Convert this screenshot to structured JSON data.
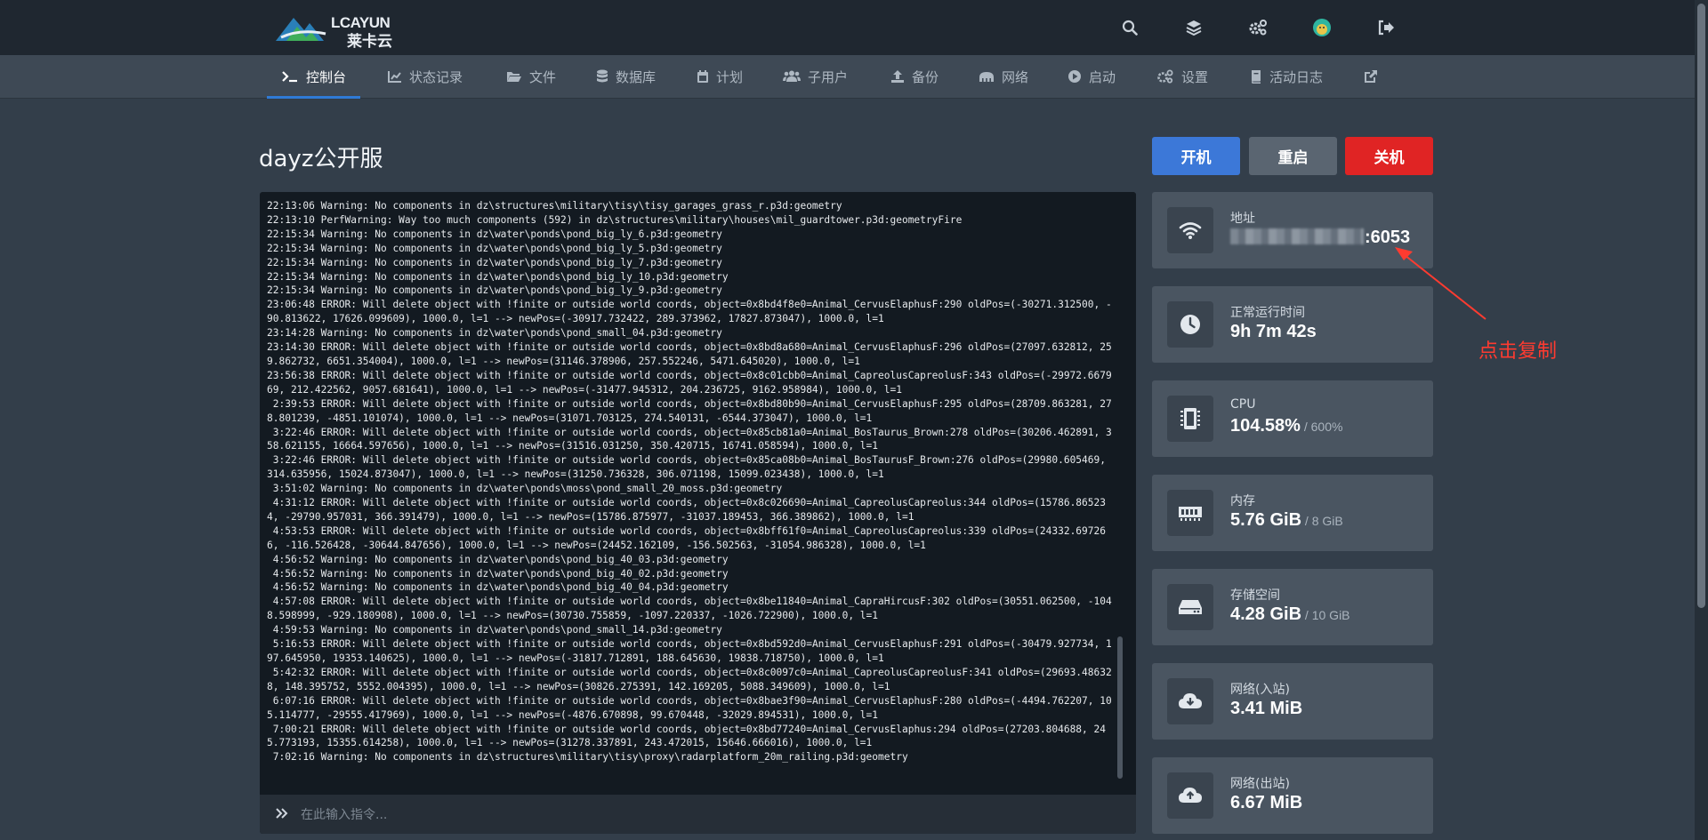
{
  "header": {
    "logo_en": "LCAYUN",
    "logo_cn": "莱卡云",
    "icons": [
      "search-icon",
      "layers-icon",
      "cogs-icon",
      "avatar",
      "logout-icon"
    ]
  },
  "nav": {
    "items": [
      {
        "label": "控制台",
        "icon": "terminal-icon",
        "active": true
      },
      {
        "label": "状态记录",
        "icon": "chart-icon"
      },
      {
        "label": "文件",
        "icon": "folder-icon"
      },
      {
        "label": "数据库",
        "icon": "database-icon"
      },
      {
        "label": "计划",
        "icon": "calendar-icon"
      },
      {
        "label": "子用户",
        "icon": "users-icon"
      },
      {
        "label": "备份",
        "icon": "upload-icon"
      },
      {
        "label": "网络",
        "icon": "network-icon"
      },
      {
        "label": "启动",
        "icon": "play-icon"
      },
      {
        "label": "设置",
        "icon": "cogs-icon"
      },
      {
        "label": "活动日志",
        "icon": "book-icon"
      },
      {
        "label": "",
        "icon": "external-link-icon"
      }
    ]
  },
  "server": {
    "title": "dayz公开服"
  },
  "power": {
    "start": "开机",
    "restart": "重启",
    "stop": "关机"
  },
  "console": {
    "lines": [
      "22:13:06 Warning: No components in dz\\structures\\military\\tisy\\tisy_garages_grass_r.p3d:geometry",
      "22:13:10 PerfWarning: Way too much components (592) in dz\\structures\\military\\houses\\mil_guardtower.p3d:geometryFire",
      "22:15:34 Warning: No components in dz\\water\\ponds\\pond_big_ly_6.p3d:geometry",
      "22:15:34 Warning: No components in dz\\water\\ponds\\pond_big_ly_5.p3d:geometry",
      "22:15:34 Warning: No components in dz\\water\\ponds\\pond_big_ly_7.p3d:geometry",
      "22:15:34 Warning: No components in dz\\water\\ponds\\pond_big_ly_10.p3d:geometry",
      "22:15:34 Warning: No components in dz\\water\\ponds\\pond_big_ly_9.p3d:geometry",
      "23:06:48 ERROR: Will delete object with !finite or outside world coords, object=0x8bd4f8e0=Animal_CervusElaphusF:290 oldPos=(-30271.312500, -90.813622, 17626.099609), 1000.0, l=1 --> newPos=(-30917.732422, 289.373962, 17827.873047), 1000.0, l=1",
      "23:14:28 Warning: No components in dz\\water\\ponds\\pond_small_04.p3d:geometry",
      "23:14:30 ERROR: Will delete object with !finite or outside world coords, object=0x8bd8a680=Animal_CervusElaphusF:296 oldPos=(27097.632812, 259.862732, 6651.354004), 1000.0, l=1 --> newPos=(31146.378906, 257.552246, 5471.645020), 1000.0, l=1",
      "23:56:38 ERROR: Will delete object with !finite or outside world coords, object=0x8c01cbb0=Animal_CapreolusCapreolusF:343 oldPos=(-29972.667969, 212.422562, 9057.681641), 1000.0, l=1 --> newPos=(-31477.945312, 204.236725, 9162.958984), 1000.0, l=1",
      " 2:39:53 ERROR: Will delete object with !finite or outside world coords, object=0x8bd80b90=Animal_CervusElaphusF:295 oldPos=(28709.863281, 278.801239, -4851.101074), 1000.0, l=1 --> newPos=(31071.703125, 274.540131, -6544.373047), 1000.0, l=1",
      " 3:22:46 ERROR: Will delete object with !finite or outside world coords, object=0x85cb81a0=Animal_BosTaurus_Brown:278 oldPos=(30206.462891, 358.621155, 16664.597656), 1000.0, l=1 --> newPos=(31516.031250, 350.420715, 16741.058594), 1000.0, l=1",
      " 3:22:46 ERROR: Will delete object with !finite or outside world coords, object=0x85ca08b0=Animal_BosTaurusF_Brown:276 oldPos=(29980.605469, 314.635956, 15024.873047), 1000.0, l=1 --> newPos=(31250.736328, 306.071198, 15099.023438), 1000.0, l=1",
      " 3:51:02 Warning: No components in dz\\water\\ponds\\moss\\pond_small_20_moss.p3d:geometry",
      " 4:31:12 ERROR: Will delete object with !finite or outside world coords, object=0x8c026690=Animal_CapreolusCapreolus:344 oldPos=(15786.865234, -29790.957031, 366.391479), 1000.0, l=1 --> newPos=(15786.875977, -31037.189453, 366.389862), 1000.0, l=1",
      " 4:53:53 ERROR: Will delete object with !finite or outside world coords, object=0x8bff61f0=Animal_CapreolusCapreolus:339 oldPos=(24332.697266, -116.526428, -30644.847656), 1000.0, l=1 --> newPos=(24452.162109, -156.502563, -31054.986328), 1000.0, l=1",
      " 4:56:52 Warning: No components in dz\\water\\ponds\\pond_big_40_03.p3d:geometry",
      " 4:56:52 Warning: No components in dz\\water\\ponds\\pond_big_40_02.p3d:geometry",
      " 4:56:52 Warning: No components in dz\\water\\ponds\\pond_big_40_04.p3d:geometry",
      " 4:57:08 ERROR: Will delete object with !finite or outside world coords, object=0x8be11840=Animal_CapraHircusF:302 oldPos=(30551.062500, -1048.598999, -929.180908), 1000.0, l=1 --> newPos=(30730.755859, -1097.220337, -1026.722900), 1000.0, l=1",
      " 4:59:53 Warning: No components in dz\\water\\ponds\\pond_small_14.p3d:geometry",
      " 5:16:53 ERROR: Will delete object with !finite or outside world coords, object=0x8bd592d0=Animal_CervusElaphusF:291 oldPos=(-30479.927734, 197.645950, 19353.140625), 1000.0, l=1 --> newPos=(-31817.712891, 188.645630, 19838.718750), 1000.0, l=1",
      " 5:42:32 ERROR: Will delete object with !finite or outside world coords, object=0x8c0097c0=Animal_CapreolusCapreolusF:341 oldPos=(29693.486328, 148.395752, 5552.004395), 1000.0, l=1 --> newPos=(30826.275391, 142.169205, 5088.349609), 1000.0, l=1",
      " 6:07:16 ERROR: Will delete object with !finite or outside world coords, object=0x8bae3f90=Animal_CervusElaphusF:280 oldPos=(-4494.762207, 105.114777, -29555.417969), 1000.0, l=1 --> newPos=(-4876.670898, 99.670448, -32029.894531), 1000.0, l=1",
      " 7:00:21 ERROR: Will delete object with !finite or outside world coords, object=0x8bd77240=Animal_CervusElaphus:294 oldPos=(27203.804688, 245.773193, 15355.614258), 1000.0, l=1 --> newPos=(31278.337891, 243.472015, 15646.666016), 1000.0, l=1",
      " 7:02:16 Warning: No components in dz\\structures\\military\\tisy\\proxy\\radarplatform_20m_railing.p3d:geometry"
    ],
    "input_placeholder": "在此输入指令..."
  },
  "stats": {
    "address": {
      "label": "地址",
      "value_visible": ":6053",
      "icon": "wifi-icon"
    },
    "uptime": {
      "label": "正常运行时间",
      "value": "9h 7m 42s",
      "icon": "clock-icon"
    },
    "cpu": {
      "label": "CPU",
      "value": "104.58%",
      "limit": " / 600%",
      "icon": "cpu-icon"
    },
    "memory": {
      "label": "内存",
      "value": "5.76 GiB",
      "limit": " / 8 GiB",
      "icon": "memory-icon"
    },
    "disk": {
      "label": "存储空间",
      "value": "4.28 GiB",
      "limit": " / 10 GiB",
      "icon": "hdd-icon"
    },
    "net_in": {
      "label": "网络(入站)",
      "value": "3.41 MiB",
      "icon": "cloud-download-icon"
    },
    "net_out": {
      "label": "网络(出站)",
      "value": "6.67 MiB",
      "icon": "cloud-upload-icon"
    }
  },
  "annotation": {
    "text": "点击复制"
  },
  "colors": {
    "accent": "#3c78d8",
    "danger": "#e02424",
    "annotation": "#ff3b30"
  }
}
